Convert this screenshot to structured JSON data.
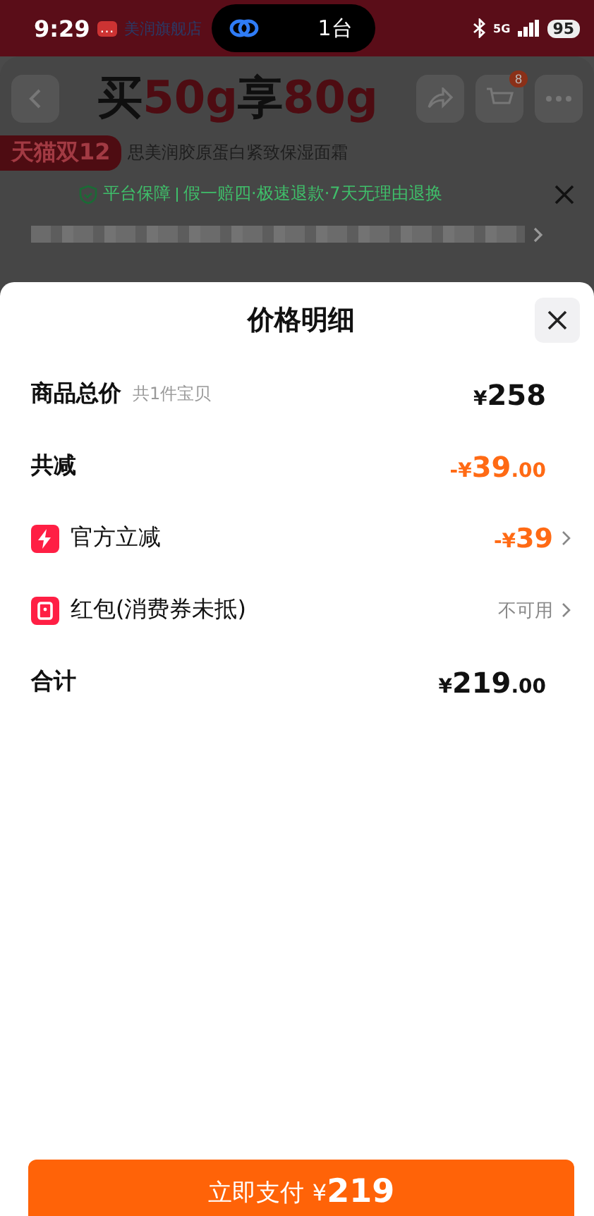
{
  "status_bar": {
    "time": "9:29",
    "notification": "…",
    "island_text": "1台",
    "network": "5G",
    "battery": "95"
  },
  "background": {
    "store_name": "美润旗舰店",
    "headline": [
      {
        "text": "买",
        "accent": false
      },
      {
        "text": "50g",
        "accent": true
      },
      {
        "text": "享",
        "accent": false
      },
      {
        "text": "80g",
        "accent": true
      }
    ],
    "cart_count": "8",
    "product_title": "思美润胶原蛋白紧致保湿面霜",
    "corner_badge": "天猫双12",
    "guarantee": {
      "label": "平台保障",
      "items": "假一赔四·极速退款·7天无理由退换"
    }
  },
  "sheet": {
    "title": "价格明细",
    "rows": [
      {
        "kind": "amount",
        "label": "商品总价",
        "note": "共1件宝贝",
        "prefix": "¥",
        "main": "258",
        "accent": false
      },
      {
        "kind": "amount",
        "label": "共减",
        "prefix": "-¥",
        "main": "39",
        "decimals": ".00",
        "accent": true
      },
      {
        "kind": "link",
        "label": "官方立减",
        "prefix": "-¥",
        "main": "39",
        "accent": true
      },
      {
        "kind": "link",
        "label": "红包(消费券未抵)",
        "status": "不可用"
      },
      {
        "kind": "amount",
        "label": "合计",
        "prefix": "¥",
        "main": "219",
        "decimals": ".00",
        "accent": false
      }
    ],
    "pay_button": {
      "label": "立即支付",
      "currency": "¥",
      "amount": "219"
    }
  }
}
